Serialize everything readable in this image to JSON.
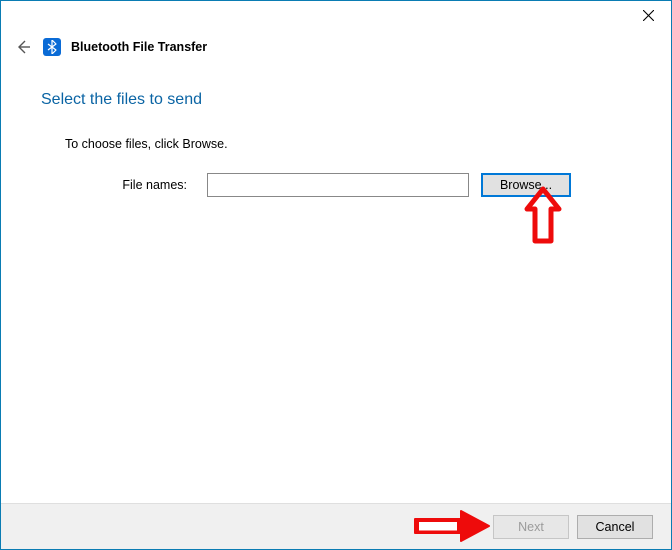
{
  "header": {
    "title": "Bluetooth File Transfer"
  },
  "main": {
    "heading": "Select the files to send",
    "instruction": "To choose files, click Browse.",
    "fileLabel": "File names:",
    "fileValue": "",
    "browseLabel": "Browse..."
  },
  "footer": {
    "nextLabel": "Next",
    "cancelLabel": "Cancel"
  }
}
